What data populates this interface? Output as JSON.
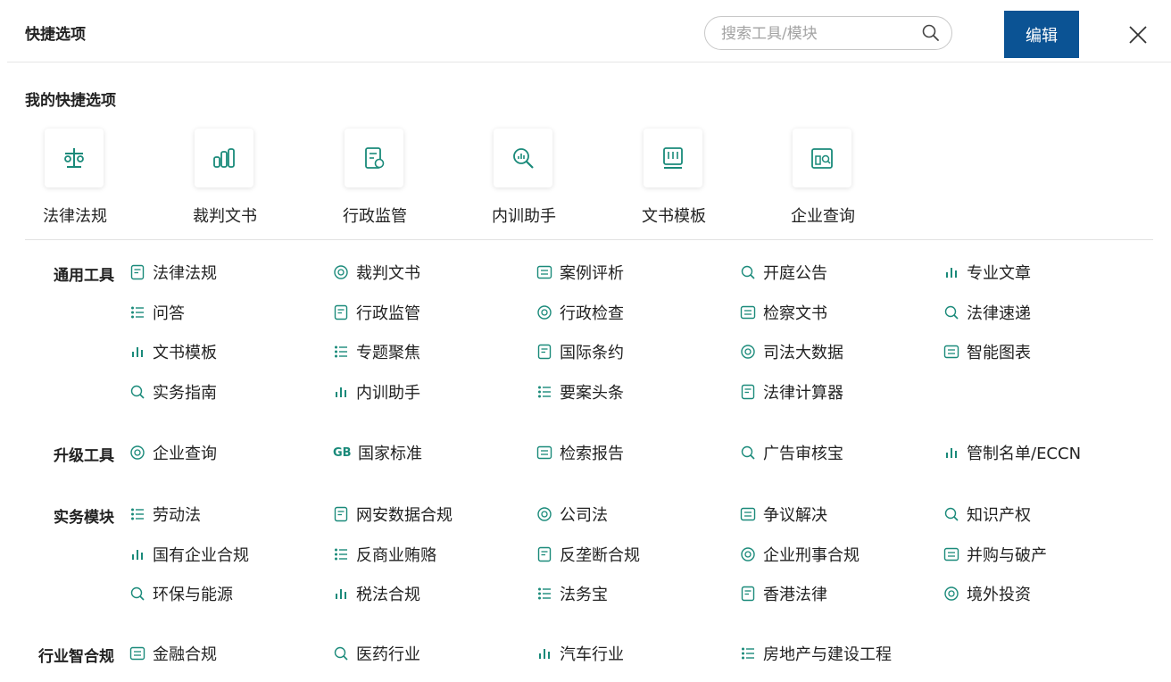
{
  "header": {
    "title": "快捷选项",
    "search_placeholder": "搜索工具/模块",
    "edit_label": "编辑"
  },
  "my_quick": {
    "title": "我的快捷选项",
    "items": [
      {
        "label": "法律法规",
        "icon": "scale-icon"
      },
      {
        "label": "裁判文书",
        "icon": "books-icon"
      },
      {
        "label": "行政监管",
        "icon": "admin-doc-icon"
      },
      {
        "label": "内训助手",
        "icon": "magnifier-chart-icon"
      },
      {
        "label": "文书模板",
        "icon": "template-icon"
      },
      {
        "label": "企业查询",
        "icon": "company-search-icon"
      }
    ]
  },
  "groups": [
    {
      "label": "通用工具",
      "tools": [
        [
          "法律法规",
          "裁判文书",
          "案例评析",
          "开庭公告",
          "专业文章"
        ],
        [
          "问答",
          "行政监管",
          "行政检查",
          "检察文书",
          "法律速递"
        ],
        [
          "文书模板",
          "专题聚焦",
          "国际条约",
          "司法大数据",
          "智能图表"
        ],
        [
          "实务指南",
          "内训助手",
          "要案头条",
          "法律计算器"
        ]
      ]
    },
    {
      "label": "升级工具",
      "tools": [
        [
          "企业查询",
          "国家标准",
          "检索报告",
          "广告审核宝",
          "管制名单/ECCN"
        ]
      ],
      "gb_text": "GB"
    },
    {
      "label": "实务模块",
      "tools": [
        [
          "劳动法",
          "网安数据合规",
          "公司法",
          "争议解决",
          "知识产权"
        ],
        [
          "国有企业合规",
          "反商业贿赂",
          "反垄断合规",
          "企业刑事合规",
          "并购与破产"
        ],
        [
          "环保与能源",
          "税法合规",
          "法务宝",
          "香港法律",
          "境外投资"
        ]
      ]
    },
    {
      "label": "行业智合规",
      "tools": [
        [
          "金融合规",
          "医药行业",
          "汽车行业",
          "房地产与建设工程"
        ]
      ]
    }
  ],
  "colors": {
    "accent": "#0b5394",
    "icon": "#1a8a7a"
  }
}
